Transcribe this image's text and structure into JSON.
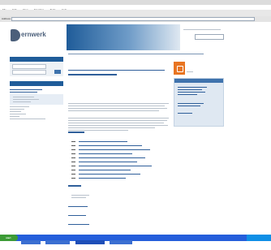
{
  "browser": {
    "title_bar": "",
    "menu": [
      "File",
      "Edit",
      "View",
      "Favorites",
      "Tools",
      "Help"
    ],
    "address_label": "Address",
    "address_value": ""
  },
  "site": {
    "logo_text": "ernwerk",
    "tagline": "",
    "sidebar_box1_title": "",
    "sidebar_box2_title": "",
    "right_box_title": "",
    "footer_links": []
  },
  "taskbar": {
    "start_label": "start"
  },
  "colors": {
    "brand_blue": "#1f5c99",
    "light_blue": "#3f73ad",
    "accent_orange": "#e87522",
    "taskbar_blue": "#245edb",
    "start_green": "#3c9b35"
  }
}
